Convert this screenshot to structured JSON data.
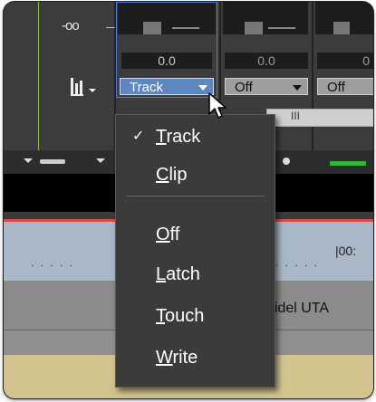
{
  "mixer": {
    "db_label": "-oo",
    "channels": [
      {
        "value": "0.0",
        "automation": "Track"
      },
      {
        "value": "0.0",
        "automation": "Off"
      },
      {
        "value": "0",
        "automation": "Off"
      }
    ]
  },
  "scroll": {
    "thumb_glyph": "III"
  },
  "ruler": {
    "time_label": "|00:",
    "dots": ". . . . ."
  },
  "track": {
    "clip_name": "eidel UTA"
  },
  "menu": {
    "items": [
      {
        "label": "Track",
        "checked": true,
        "check_glyph": "✓"
      },
      {
        "label": "Clip",
        "checked": false
      },
      {
        "label": "Off",
        "checked": false
      },
      {
        "label": "Latch",
        "checked": false
      },
      {
        "label": "Touch",
        "checked": false
      },
      {
        "label": "Write",
        "checked": false
      }
    ]
  },
  "icons": [
    "meter-icon",
    "dropdown-arrow-icon",
    "checkmark-icon",
    "mouse-cursor-icon"
  ]
}
